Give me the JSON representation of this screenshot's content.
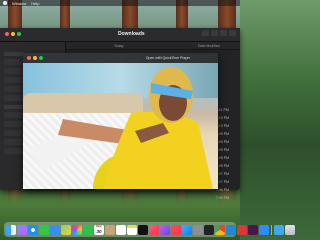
{
  "menubar": {
    "items": [
      "Window",
      "Help"
    ]
  },
  "finder": {
    "title": "Downloads",
    "header": {
      "today": "Today",
      "date_modified": "Date Modified"
    },
    "times": [
      "7:11 PM",
      "7:10 PM",
      "7:10 PM",
      "7:09 PM",
      "7:09 PM",
      "7:09 PM",
      "7:08 PM",
      "7:08 PM",
      "7:07 PM",
      "7:07 PM",
      "7:06 PM",
      "7:05 PM"
    ]
  },
  "player": {
    "open_with": "Open with QuickTime Player"
  },
  "dock": {
    "calendar_month": "DEC",
    "calendar_day": "30",
    "apps": [
      "finder-icon",
      "launchpad-icon",
      "safari-icon",
      "messages-icon",
      "mail-icon",
      "maps-icon",
      "photos-icon",
      "facetime-icon",
      "calendar-icon",
      "contacts-icon",
      "reminders-icon",
      "notes-icon",
      "tv-icon",
      "music-icon",
      "podcasts-icon",
      "news-icon",
      "app-store-icon",
      "system-settings-icon",
      "terminal-icon",
      "chrome-icon",
      "vscode-icon",
      "photo-booth-icon",
      "slack-icon",
      "zoom-icon",
      "downloads-folder-icon",
      "trash-icon"
    ]
  },
  "colors": {
    "close": "#ff5f57",
    "minimize": "#febc2e",
    "zoom": "#28c840",
    "accent": "#0a84ff"
  }
}
